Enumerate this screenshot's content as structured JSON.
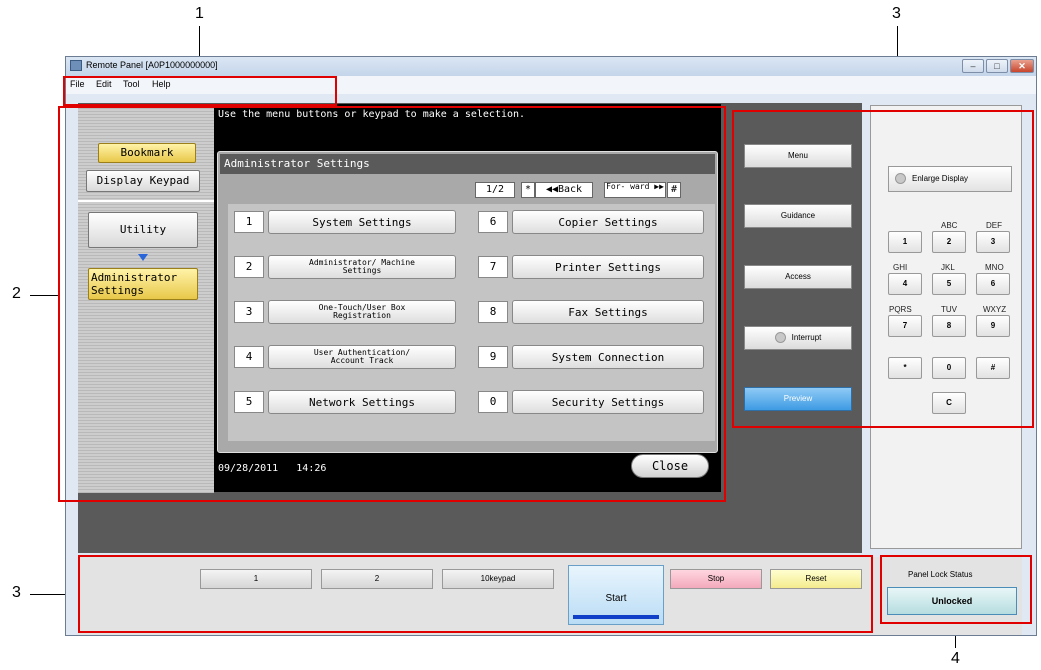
{
  "callouts": {
    "c1": "1",
    "c2": "2",
    "c3_top": "3",
    "c3_left": "3",
    "c4": "4"
  },
  "window": {
    "title": "Remote Panel [A0P1000000000]",
    "controls": {
      "minimize": "–",
      "maximize": "□",
      "close": "✕"
    }
  },
  "menubar": {
    "file": "File",
    "edit": "Edit",
    "tool": "Tool",
    "help": "Help"
  },
  "left_panel": {
    "bookmark": "Bookmark",
    "display_keypad": "Display Keypad",
    "utility": "Utility",
    "administrator_settings": "Administrator Settings"
  },
  "screen": {
    "message": "Use the menu buttons or keypad to make a selection.",
    "dialog_title": "Administrator Settings",
    "page": "1/2",
    "star_key": "*",
    "back": "◀◀Back",
    "forward": "For- ward ▶▶",
    "hash_key": "#",
    "settings": [
      {
        "num": "1",
        "label": "System Settings"
      },
      {
        "num": "2",
        "label": "Administrator/ Machine Settings"
      },
      {
        "num": "3",
        "label": "One-Touch/User Box Registration"
      },
      {
        "num": "4",
        "label": "User Authentication/ Account Track"
      },
      {
        "num": "5",
        "label": "Network Settings"
      },
      {
        "num": "6",
        "label": "Copier Settings"
      },
      {
        "num": "7",
        "label": "Printer Settings"
      },
      {
        "num": "8",
        "label": "Fax Settings"
      },
      {
        "num": "9",
        "label": "System Connection"
      },
      {
        "num": "0",
        "label": "Security Settings"
      }
    ],
    "date": "09/28/2011",
    "time": "14:26",
    "close": "Close"
  },
  "side_buttons": {
    "menu": "Menu",
    "guidance": "Guidance",
    "access": "Access",
    "interrupt": "Interrupt",
    "preview": "Preview"
  },
  "keypad": {
    "enlarge": "Enlarge Display",
    "letters": {
      "abc": "ABC",
      "def": "DEF",
      "ghi": "GHI",
      "jkl": "JKL",
      "mno": "MNO",
      "pqrs": "PQRS",
      "tuv": "TUV",
      "wxyz": "WXYZ"
    },
    "keys": {
      "k1": "1",
      "k2": "2",
      "k3": "3",
      "k4": "4",
      "k5": "5",
      "k6": "6",
      "k7": "7",
      "k8": "8",
      "k9": "9",
      "kstar": "*",
      "k0": "0",
      "khash": "#",
      "kc": "C"
    }
  },
  "bottom": {
    "b1": "1",
    "b2": "2",
    "tenkey": "10keypad",
    "start": "Start",
    "stop": "Stop",
    "reset": "Reset",
    "lock_title": "Panel Lock Status",
    "lock_state": "Unlocked"
  },
  "colors": {
    "callout_frame": "#e00000",
    "start_bar": "#1040c8",
    "preview": "#3e9be3",
    "stop": "#f3a9bb",
    "reset": "#f4eb8e"
  }
}
